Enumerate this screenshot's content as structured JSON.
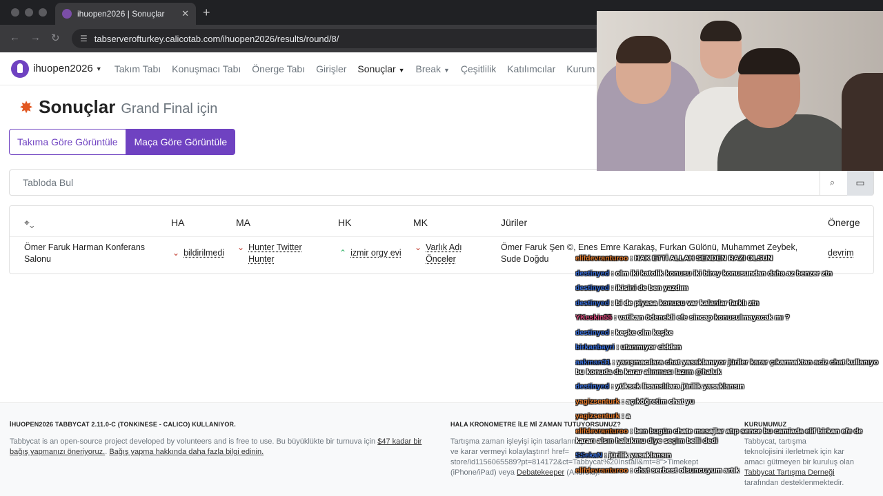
{
  "browser": {
    "tab_title": "ihuopen2026 | Sonuçlar",
    "tab_close": "✕",
    "new_tab": "+",
    "url": "tabserverofturkey.calicotab.com/ihuopen2026/results/round/8/"
  },
  "nav": {
    "brand": "ihuopen2026",
    "items": [
      "Takım Tabı",
      "Konuşmacı Tabı",
      "Önerge Tabı",
      "Girişler",
      "Sonuçlar",
      "Break",
      "Çeşitlilik",
      "Katılımcılar",
      "Kurum"
    ]
  },
  "page": {
    "title": "Sonuçlar",
    "subtitle": "Grand Final için",
    "btn_team": "Takıma Göre Görüntüle",
    "btn_debate": "Maça Göre Görüntüle",
    "search_placeholder": "Tabloda Bul"
  },
  "table": {
    "headers": {
      "ha": "HA",
      "ma": "MA",
      "hk": "HK",
      "mk": "MK",
      "juries": "Jüriler",
      "motion": "Önerge"
    },
    "row": {
      "venue": "Ömer Faruk Harman Konferans Salonu",
      "ha": "bildirilmedi",
      "ma": "Hunter Twitter Hunter",
      "hk": "izmir orgy evi",
      "mk": "Varlık Adı Önceler",
      "juries": "Ömer Faruk Şen ©, Enes Emre Karakaş, Furkan Gülönü, Muhammet Zeybek, Sude Doğdu",
      "motion": "devrim"
    }
  },
  "footer": {
    "col1_title": "İHUOPEN2026 TABBYCAT 2.11.0-C (TONKINESE - CALICO) KULLANIYOR.",
    "col1_text": "Tabbycat is an open-source project developed by volunteers and is free to use. Bu büyüklükte bir turnuva için",
    "col1_link1": "$47 kadar bir bağış yapmanızı öneriyoruz.",
    "col1_sep": ". ",
    "col1_link2": "Bağış yapma hakkında daha fazla bilgi edinin.",
    "col2_title": "HALA KRONOMETRE İLE Mİ ZAMAN TUTUYORSUNUZ?",
    "col2_text1": "Tartışma zaman işleyişi için tasarlanmış ",
    "col2_text2": "ve karar vermeyi kolaylaştırır! href=",
    "col2_text3": "store/id1156065589?pt=814172&ct=Tabbycat%20Install&mt=8\">Timekept",
    "col2_text4": "(iPhone/iPad) veya",
    "col2_link": "Debatekeeper",
    "col2_text5": "(Android).",
    "col3_title": "KURUMUMUZ",
    "col3_text1": "Tabbycat, tartışma",
    "col3_text2": "teknolojisini ilerletmek için kar",
    "col3_text3": "amacı gütmeyen bir kuruluş olan",
    "col3_link": "Tabbycat Tartışma Derneği",
    "col3_text4": "tarafından desteklenmektedir."
  },
  "chat": [
    {
      "user": "elifdevranturoo",
      "color": "#e07b2f",
      "text": ": HAK ETTİ ALLAH SENDEN RAZI OLSUN"
    },
    {
      "user": "destinyed",
      "color": "#3a6fd8",
      "text": ": olm iki katolik konusu iki birey konusundan daha az benzer ztn"
    },
    {
      "user": "destinyed",
      "color": "#3a6fd8",
      "text": ": ikisini de ben yazdım"
    },
    {
      "user": "destinyed",
      "color": "#3a6fd8",
      "text": ": bi de piyasa konusu var kalanlar farklı ztn"
    },
    {
      "user": "YKeskin55",
      "color": "#d44a7a",
      "text": ": vatikan ödenekli efe sincap konusulmayacak mı ?"
    },
    {
      "user": "destinyed",
      "color": "#3a6fd8",
      "text": ": keşke olm keşke"
    },
    {
      "user": "birkanbayri",
      "color": "#3a6fd8",
      "text": ": utanmıyor cidden"
    },
    {
      "user": "aakman31",
      "color": "#3a6fd8",
      "text": ": yarışmacılara chat yasaklanıyor jüriler karar çıkarmaktan aciz chat kullanıyo bu konuda da karar alınması lazım @haluk"
    },
    {
      "user": "destinyed",
      "color": "#3a6fd8",
      "text": ": yüksek lisanslılara jürilik yasaklansın"
    },
    {
      "user": "yagizsenturk",
      "color": "#e07b2f",
      "text": ": açıköğretim chat yu"
    },
    {
      "user": "yagizsenturk",
      "color": "#e07b2f",
      "text": ": a"
    },
    {
      "user": "elifdevranturoo",
      "color": "#e07b2f",
      "text": ": ben bugün chate mesajlar atıp sence bu camiada elif birkan efe de kararı alsın halukmu diye seçim belli dedi"
    },
    {
      "user": "SSekaN",
      "color": "#3a6fd8",
      "text": ": jürilik yasaklansın"
    },
    {
      "user": "elifdevranturoo",
      "color": "#e07b2f",
      "text": ": chat serbest olsuncuyum artık"
    }
  ]
}
